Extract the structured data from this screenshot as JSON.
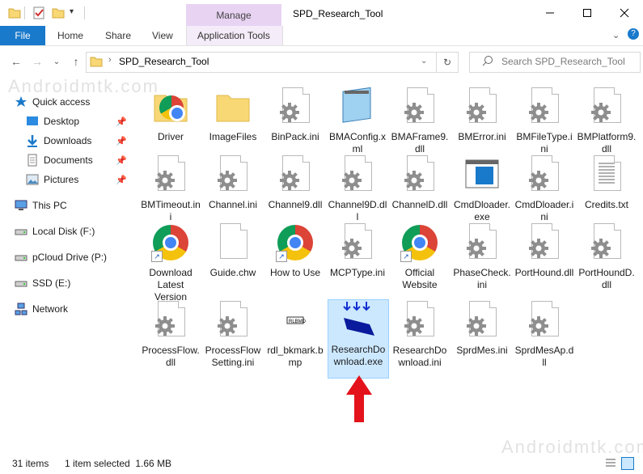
{
  "title_bar": {
    "manage_label": "Manage",
    "window_title": "SPD_Research_Tool"
  },
  "ribbon": {
    "tabs": [
      "File",
      "Home",
      "Share",
      "View"
    ],
    "app_tools": "Application Tools"
  },
  "address": {
    "path": "SPD_Research_Tool",
    "search_placeholder": "Search SPD_Research_Tool"
  },
  "nav_pane": {
    "quick_access": "Quick access",
    "items": [
      "Desktop",
      "Downloads",
      "Documents",
      "Pictures"
    ],
    "this_pc": "This PC",
    "drives": [
      "Local Disk (F:)",
      "pCloud Drive (P:)",
      "SSD (E:)"
    ],
    "network": "Network"
  },
  "files": [
    {
      "name": "Driver",
      "icon": "chrome-folder"
    },
    {
      "name": "ImageFiles",
      "icon": "folder"
    },
    {
      "name": "BinPack.ini",
      "icon": "settings-file"
    },
    {
      "name": "BMAConfig.xml",
      "icon": "notepad"
    },
    {
      "name": "BMAFrame9.dll",
      "icon": "settings-file"
    },
    {
      "name": "BMError.ini",
      "icon": "settings-file"
    },
    {
      "name": "BMFileType.ini",
      "icon": "settings-file"
    },
    {
      "name": "BMPlatform9.dll",
      "icon": "settings-file"
    },
    {
      "name": "BMTimeout.ini",
      "icon": "settings-file"
    },
    {
      "name": "Channel.ini",
      "icon": "settings-file"
    },
    {
      "name": "Channel9.dll",
      "icon": "settings-file"
    },
    {
      "name": "Channel9D.dll",
      "icon": "settings-file"
    },
    {
      "name": "ChannelD.dll",
      "icon": "settings-file"
    },
    {
      "name": "CmdDloader.exe",
      "icon": "app-window"
    },
    {
      "name": "CmdDloader.ini",
      "icon": "settings-file"
    },
    {
      "name": "Credits.txt",
      "icon": "text-file"
    },
    {
      "name": "Download Latest Version",
      "icon": "chrome-shortcut"
    },
    {
      "name": "Guide.chw",
      "icon": "blank-file"
    },
    {
      "name": "How to Use",
      "icon": "chrome-shortcut"
    },
    {
      "name": "MCPType.ini",
      "icon": "settings-file"
    },
    {
      "name": "Official Website",
      "icon": "chrome-shortcut"
    },
    {
      "name": "PhaseCheck.ini",
      "icon": "settings-file"
    },
    {
      "name": "PortHound.dll",
      "icon": "settings-file"
    },
    {
      "name": "PortHoundD.dll",
      "icon": "settings-file"
    },
    {
      "name": "ProcessFlow.dll",
      "icon": "settings-file"
    },
    {
      "name": "ProcessFlowSetting.ini",
      "icon": "settings-file"
    },
    {
      "name": "rdl_bkmark.bmp",
      "icon": "bitmap"
    },
    {
      "name": "ResearchDownload.exe",
      "icon": "research-exe"
    },
    {
      "name": "ResearchDownload.ini",
      "icon": "settings-file"
    },
    {
      "name": "SprdMes.ini",
      "icon": "settings-file"
    },
    {
      "name": "SprdMesAp.dll",
      "icon": "settings-file"
    }
  ],
  "status": {
    "count": "31 items",
    "selected": "1 item selected  1.66 MB"
  },
  "watermark": "Androidmtk.com",
  "colors": {
    "accent": "#1979ca",
    "manage": "#e8d3f3",
    "selection": "#cce8ff",
    "arrow": "#e3121b"
  }
}
